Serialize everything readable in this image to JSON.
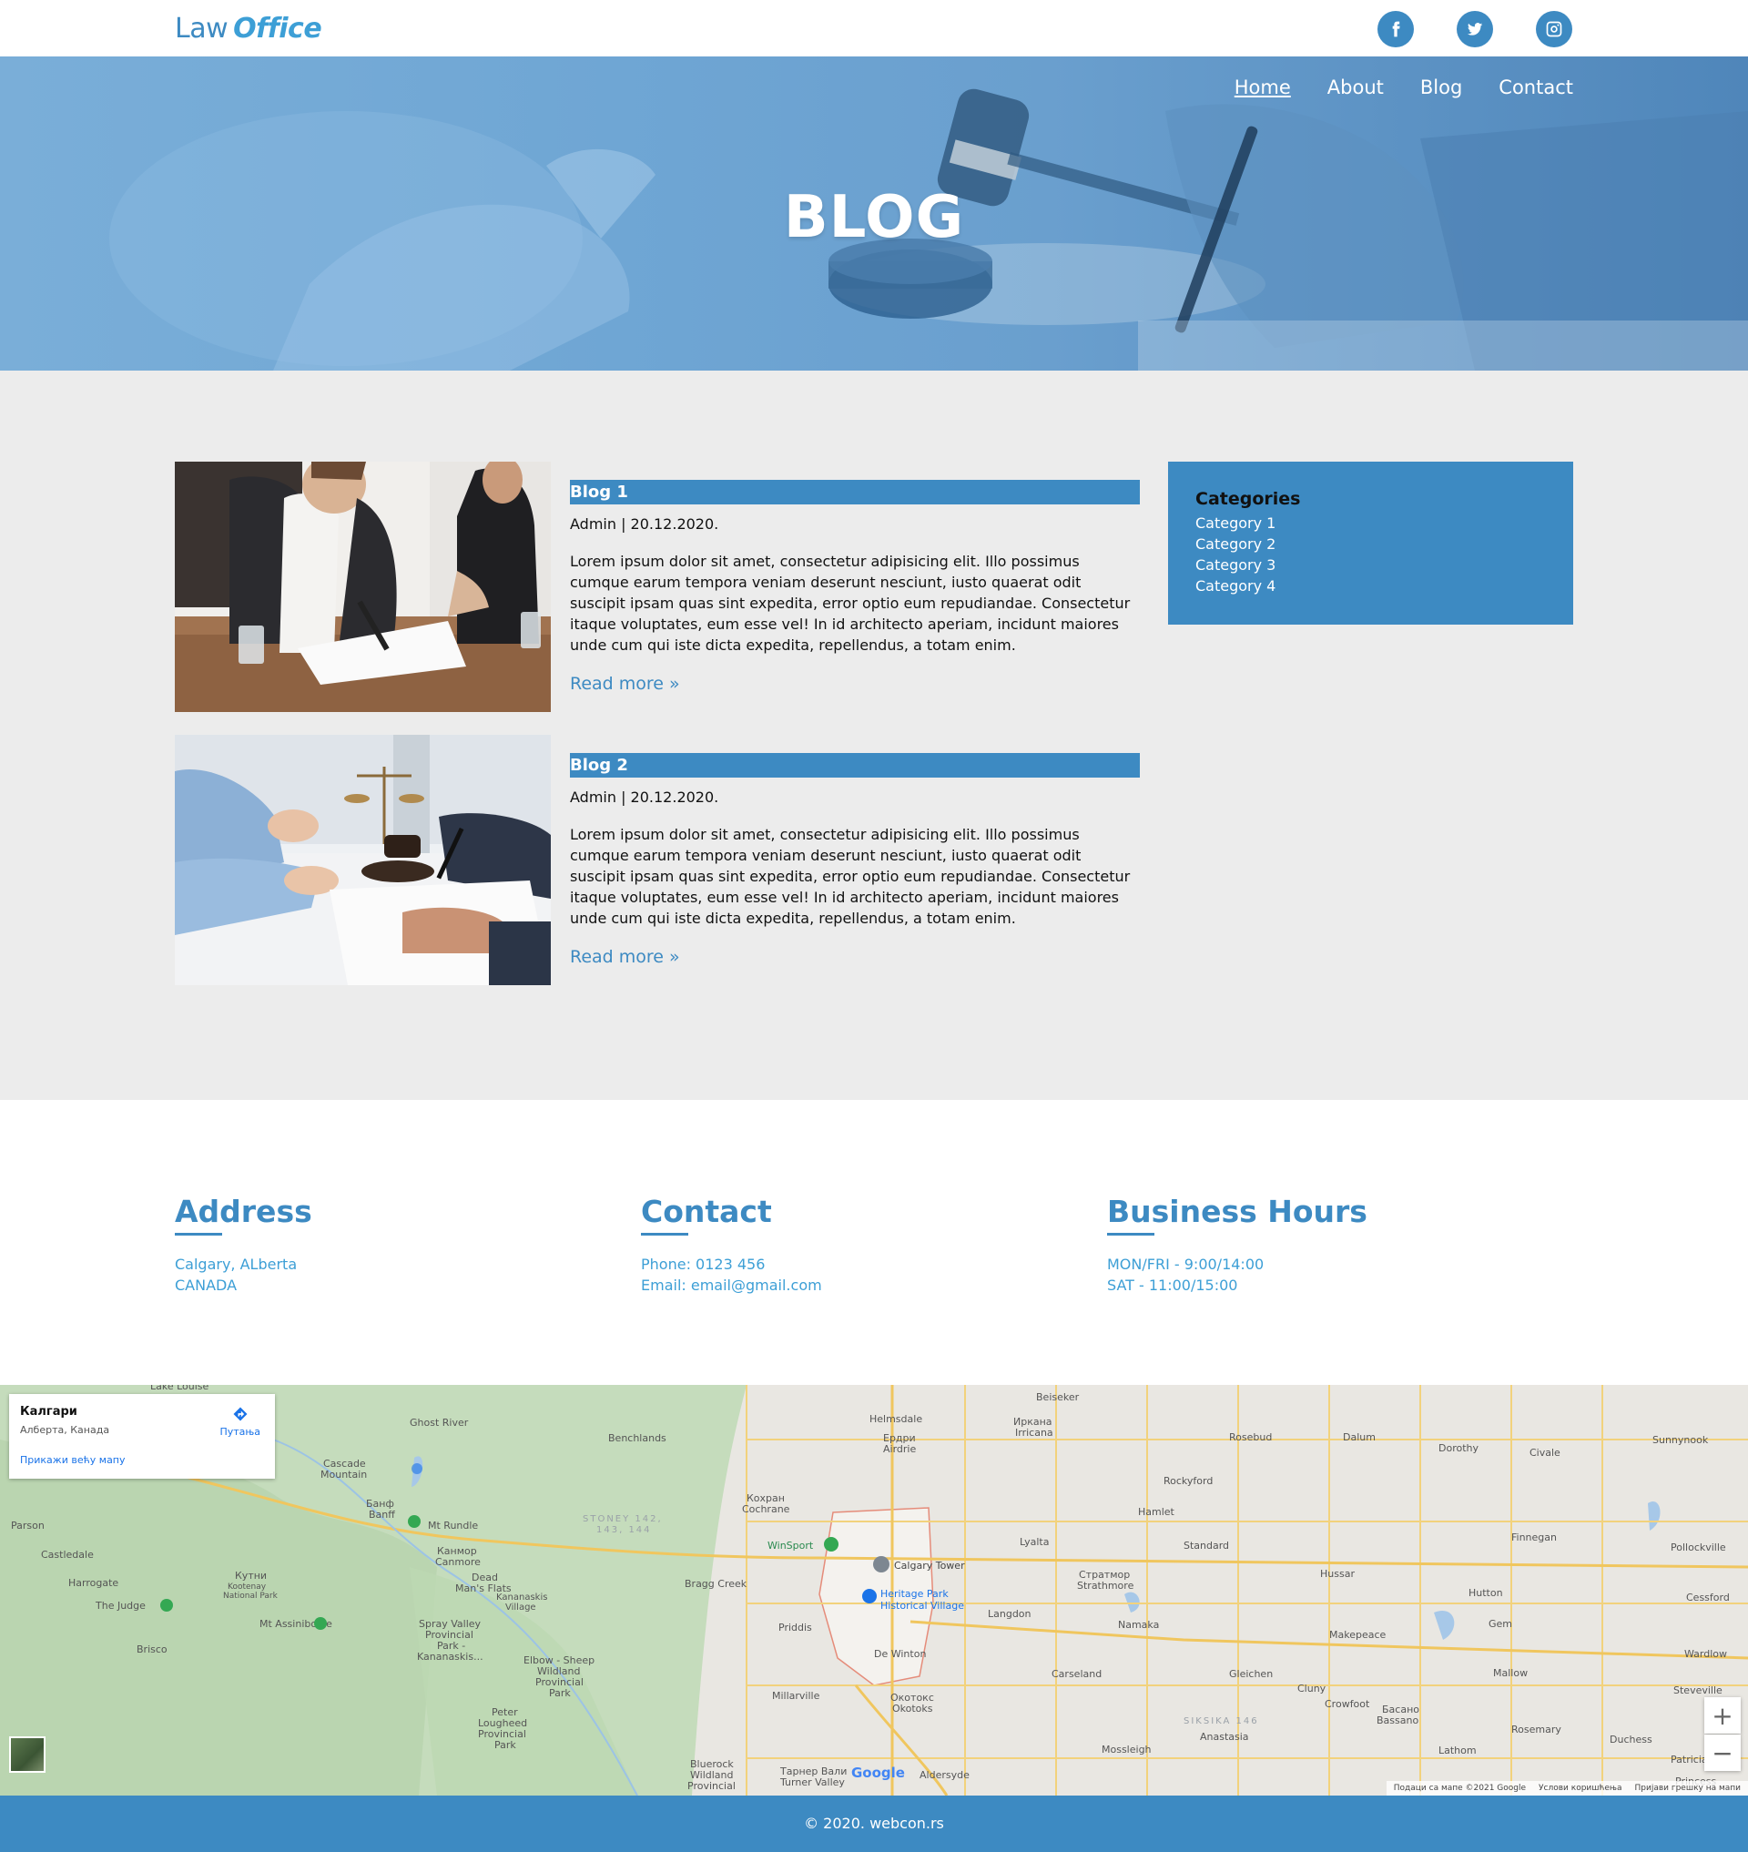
{
  "header": {
    "logo_primary": "Law",
    "logo_secondary": "Office",
    "social": [
      "facebook-icon",
      "twitter-icon",
      "instagram-icon"
    ]
  },
  "nav": {
    "items": [
      {
        "label": "Home",
        "active": true
      },
      {
        "label": "About",
        "active": false
      },
      {
        "label": "Blog",
        "active": false
      },
      {
        "label": "Contact",
        "active": false
      }
    ]
  },
  "hero": {
    "title": "BLOG"
  },
  "posts": [
    {
      "title": "Blog 1",
      "meta": "Admin | 20.12.2020.",
      "text": "Lorem ipsum dolor sit amet, consectetur adipisicing elit. Illo possimus cumque earum tempora veniam deserunt nesciunt, iusto quaerat odit suscipit ipsam quas sint expedita, error optio eum repudiandae. Consectetur itaque voluptates, eum esse vel! In id architecto aperiam, incidunt maiores unde cum qui iste dicta expedita, repellendus, a totam enim.",
      "read_more": "Read more »"
    },
    {
      "title": "Blog 2",
      "meta": "Admin | 20.12.2020.",
      "text": "Lorem ipsum dolor sit amet, consectetur adipisicing elit. Illo possimus cumque earum tempora veniam deserunt nesciunt, iusto quaerat odit suscipit ipsam quas sint expedita, error optio eum repudiandae. Consectetur itaque voluptates, eum esse vel! In id architecto aperiam, incidunt maiores unde cum qui iste dicta expedita, repellendus, a totam enim.",
      "read_more": "Read more »"
    }
  ],
  "categories": {
    "title": "Categories",
    "items": [
      "Category 1",
      "Category 2",
      "Category 3",
      "Category 4"
    ]
  },
  "info": {
    "address": {
      "title": "Address",
      "lines": [
        "Calgary, ALberta",
        "CANADA"
      ]
    },
    "contact": {
      "title": "Contact",
      "lines": [
        "Phone: 0123 456",
        "Email: email@gmail.com"
      ]
    },
    "hours": {
      "title": "Business Hours",
      "lines": [
        "MON/FRI - 9:00/14:00",
        "SAT - 11:00/15:00"
      ]
    }
  },
  "map": {
    "place_title": "Калгари",
    "place_subtitle": "Алберта, Канада",
    "directions_label": "Путања",
    "larger_map_link": "Прикажи већу мапу",
    "zoom_in": "+",
    "zoom_out": "−",
    "google_logo": "Google",
    "attribution": [
      "Подаци са мапе ©2021 Google",
      "Услови коришћења",
      "Пријави грешку на мапи"
    ],
    "labels": [
      "Lake Louise",
      "Ghost River",
      "Cascade Mountain",
      "Банф Banff",
      "Mt Rundle",
      "Канмор Canmore",
      "Dead Man's Flats",
      "Кутни Kootenay National Park",
      "The Judge",
      "Mt Assiniboine",
      "Harrogate",
      "Castledale",
      "Parson",
      "Brisco",
      "Spray Valley Provincial Park",
      "Kananaskis Village",
      "Elbow - Sheep Wildland Provincial Park",
      "Peter Lougheed Provincial Park",
      "Bluerock Wildland Provincial",
      "Benchlands",
      "Helmsdale",
      "Ердри Airdrie",
      "Кохран Cochrane",
      "WinSport",
      "Calgary Tower",
      "Heritage Park Historical Village",
      "Bragg Creek",
      "Priddis",
      "De Winton",
      "Millarville",
      "Окотокс Okotoks",
      "Тарнер Вали Turner Valley",
      "Aldersyde",
      "Beiseker",
      "Иркана Irricana",
      "Rockyford",
      "Rosebud",
      "Dalum",
      "Dorothy",
      "Civale",
      "Sunnynook",
      "Hamlet",
      "Lyalta",
      "Standard",
      "Стратмор Strathmore",
      "Hussar",
      "Finnegan",
      "Pollockville",
      "Langdon",
      "Namaka",
      "Hutton",
      "Cessford",
      "Makepeace",
      "Gem",
      "Wardlow",
      "Carseland",
      "Gleichen",
      "Cluny",
      "Crowfoot",
      "Mallow",
      "Steveville",
      "Басано Bassano",
      "Rosemary",
      "Anastasia",
      "Mossleigh",
      "Lathom",
      "Duchess",
      "Patricia",
      "Princess",
      "STONEY 142, 143, 144",
      "SIKSIKA 146"
    ]
  },
  "footer": {
    "copyright": "© 2020. webcon.rs"
  },
  "colors": {
    "accent": "#3d8ac2",
    "accent_light": "#3d9fd6",
    "content_bg": "#ececec",
    "map_green": "#c9dfc0",
    "map_grey": "#e8e6e1",
    "road_yellow": "#f4d27a"
  }
}
